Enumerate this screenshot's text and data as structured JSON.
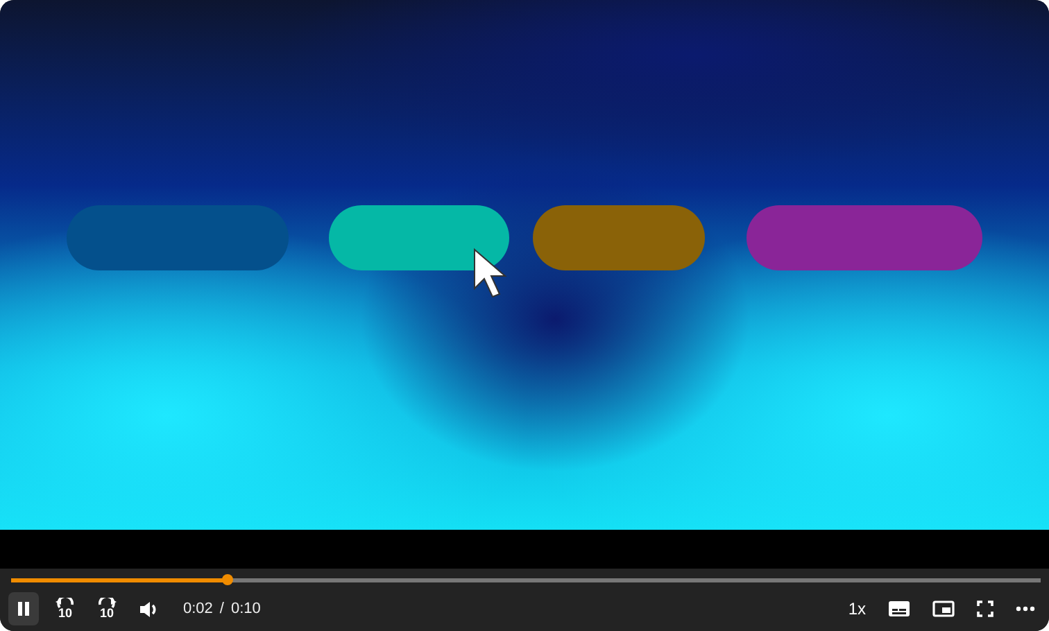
{
  "controls": {
    "playing": true,
    "progress": {
      "level": 0.21
    },
    "skip_back": "10",
    "skip_forward": "10",
    "current_time": "0:02",
    "separator": "/",
    "duration": "0:10",
    "speed": "1x"
  }
}
